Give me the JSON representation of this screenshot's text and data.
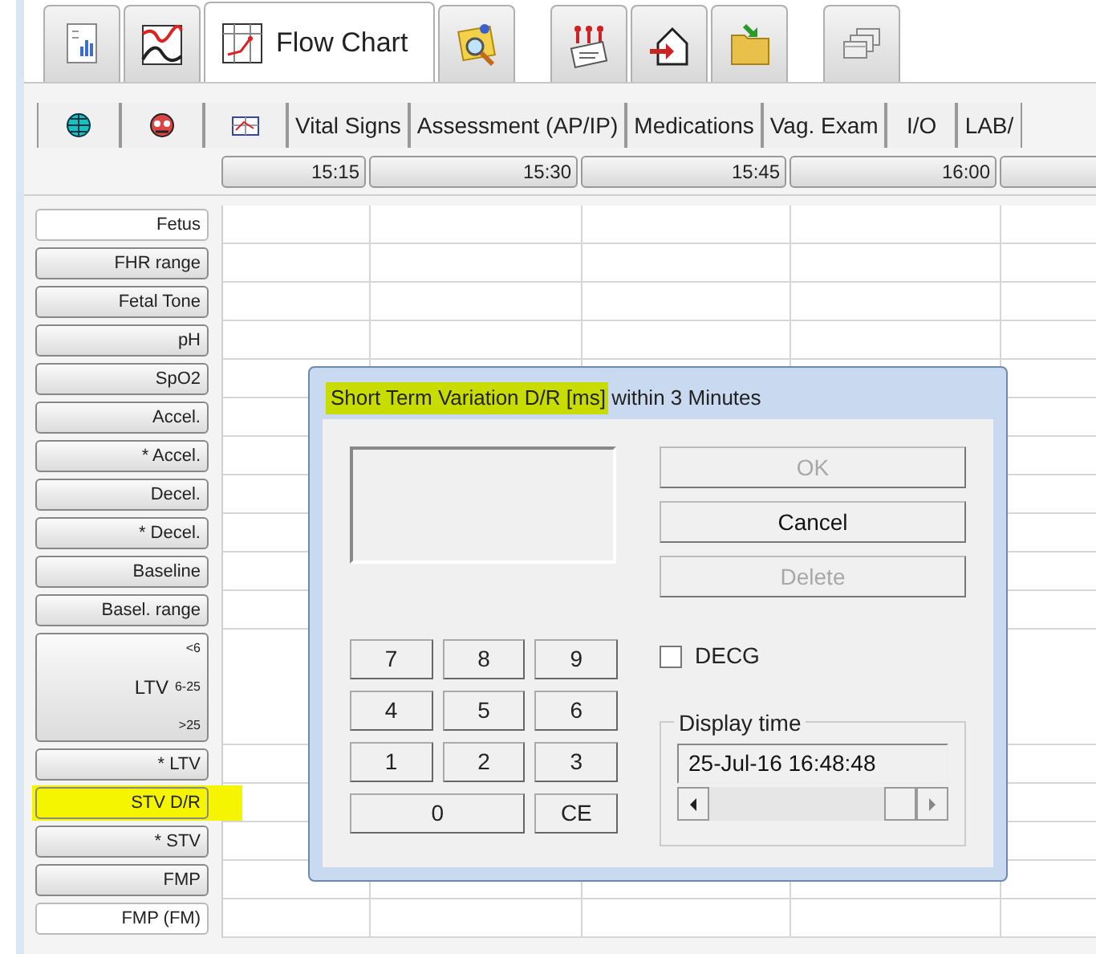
{
  "toolbar_tabs": [
    {
      "selected": false
    },
    {
      "selected": false
    },
    {
      "label": "Flow Chart",
      "selected": true
    },
    {
      "selected": false
    },
    {
      "selected": false
    },
    {
      "selected": false
    },
    {
      "selected": false
    },
    {
      "selected": false
    }
  ],
  "sub_tabs": [
    {
      "kind": "icon",
      "selected": false
    },
    {
      "kind": "icon",
      "selected": false
    },
    {
      "kind": "icon",
      "selected": false
    },
    {
      "kind": "text",
      "label": "Vital Signs",
      "selected": false
    },
    {
      "kind": "text",
      "label": "Assessment (AP/IP)",
      "selected": false
    },
    {
      "kind": "text",
      "label": "Medications",
      "selected": false
    },
    {
      "kind": "text",
      "label": "Vag. Exam",
      "selected": false
    },
    {
      "kind": "text",
      "label": "I/O",
      "selected": false
    },
    {
      "kind": "text",
      "label": "LAB/",
      "selected": false
    }
  ],
  "time_columns": [
    "15:15",
    "15:30",
    "15:45",
    "16:00"
  ],
  "rows": [
    {
      "kind": "flat",
      "label": "Fetus",
      "highlighted": false
    },
    {
      "kind": "button",
      "label": "FHR range",
      "highlighted": false
    },
    {
      "kind": "button",
      "label": "Fetal Tone",
      "highlighted": false
    },
    {
      "kind": "button",
      "label": "pH",
      "highlighted": false
    },
    {
      "kind": "button",
      "label": "SpO2",
      "highlighted": false
    },
    {
      "kind": "button",
      "label": "Accel.",
      "highlighted": false
    },
    {
      "kind": "button",
      "label": "* Accel.",
      "highlighted": false
    },
    {
      "kind": "button",
      "label": "Decel.",
      "highlighted": false
    },
    {
      "kind": "button",
      "label": "* Decel.",
      "highlighted": false
    },
    {
      "kind": "button",
      "label": "Baseline",
      "highlighted": false
    },
    {
      "kind": "button",
      "label": "Basel. range",
      "highlighted": false
    },
    {
      "kind": "multi",
      "label": "LTV",
      "sublabels": [
        "<6",
        "6-25",
        ">25"
      ],
      "highlighted": false
    },
    {
      "kind": "button",
      "label": "* LTV",
      "highlighted": false
    },
    {
      "kind": "button",
      "label": "STV D/R",
      "highlighted": true
    },
    {
      "kind": "button",
      "label": "* STV",
      "highlighted": false
    },
    {
      "kind": "button",
      "label": "FMP",
      "highlighted": false
    },
    {
      "kind": "flat",
      "label": "FMP (FM)",
      "highlighted": false
    }
  ],
  "dialog": {
    "title": "Short Term Variation D/R [ms] within 3 Minutes",
    "title_highlighted": true,
    "buttons": [
      {
        "label": "OK",
        "disabled": true
      },
      {
        "label": "Cancel",
        "disabled": false
      },
      {
        "label": "Delete",
        "disabled": true
      }
    ],
    "keypad": [
      "7",
      "8",
      "9",
      "4",
      "5",
      "6",
      "1",
      "2",
      "3",
      "0",
      "CE"
    ],
    "decg": {
      "label": "DECG",
      "checked": false
    },
    "display_time": {
      "label": "Display time",
      "value": "25-Jul-16 16:48:48"
    }
  }
}
